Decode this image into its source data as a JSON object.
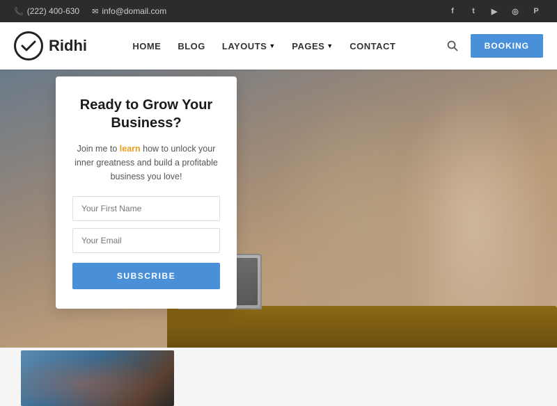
{
  "topbar": {
    "phone": "(222) 400-630",
    "email": "info@domail.com",
    "socials": [
      "f",
      "t",
      "▶",
      "◎",
      "P"
    ]
  },
  "header": {
    "logo_text": "Ridhi",
    "nav": {
      "home": "HOME",
      "blog": "BLOG",
      "layouts": "LAYOUTS",
      "pages": "PAGES",
      "contact": "CONTACT"
    },
    "booking_label": "BOOKING"
  },
  "form": {
    "heading": "Ready to Grow Your Business?",
    "desc_pre": "Join me to ",
    "desc_highlight": "learn",
    "desc_post": " how to unlock your inner greatness and build a profitable business you love!",
    "first_name_placeholder": "Your First Name",
    "email_placeholder": "Your Email",
    "subscribe_label": "SUBSCRIBE"
  }
}
